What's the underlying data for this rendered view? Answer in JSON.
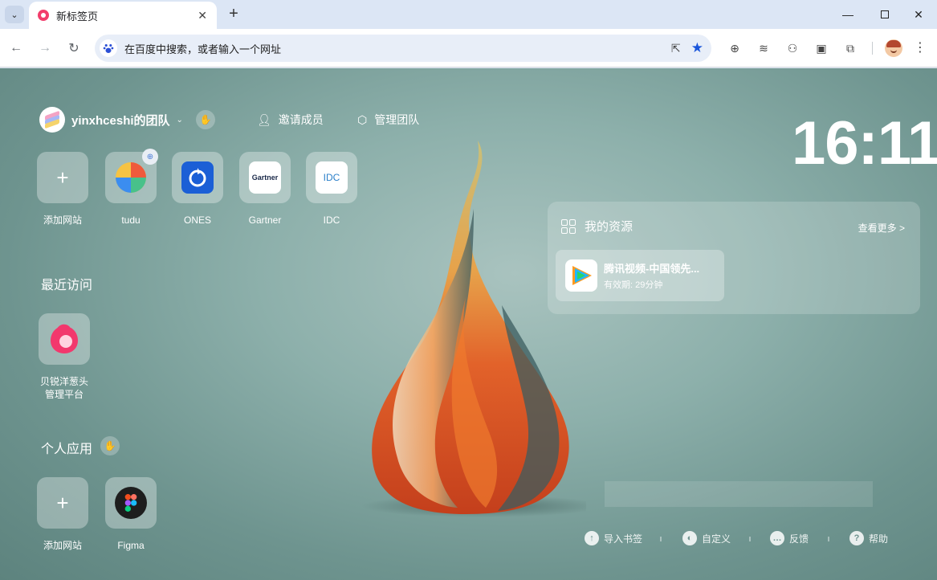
{
  "browser": {
    "tab_title": "新标签页",
    "omnibox_placeholder": "在百度中搜索，或者输入一个网址"
  },
  "team": {
    "name": "yinxhceshi的团队",
    "invite_label": "邀请成员",
    "manage_label": "管理团队"
  },
  "top_sites": [
    {
      "label": "添加网站",
      "icon": "plus-icon"
    },
    {
      "label": "tudu",
      "icon": "tudu-icon"
    },
    {
      "label": "ONES",
      "icon": "ones-icon"
    },
    {
      "label": "Gartner",
      "icon": "gartner-icon",
      "logo_text": "Gartner"
    },
    {
      "label": "IDC",
      "icon": "idc-icon",
      "logo_text": "IDC"
    }
  ],
  "recent": {
    "title": "最近访问",
    "items": [
      {
        "label_line1": "贝锐洋葱头",
        "label_line2": "管理平台",
        "icon": "onion-icon"
      }
    ]
  },
  "personal": {
    "title": "个人应用",
    "items": [
      {
        "label": "添加网站",
        "icon": "plus-icon"
      },
      {
        "label": "Figma",
        "icon": "figma-icon"
      }
    ]
  },
  "clock": {
    "time": "16:11"
  },
  "resources": {
    "title": "我的资源",
    "more_label": "查看更多 >",
    "items": [
      {
        "name": "腾讯视频-中国领先...",
        "validity": "有效期: 29分钟",
        "icon": "tencent-video-icon"
      }
    ]
  },
  "footer": {
    "import_bookmarks": "导入书签",
    "customize": "自定义",
    "feedback": "反馈",
    "help": "帮助"
  },
  "colors": {
    "background": "#8db0ab",
    "accent_star": "#1a56db",
    "tab_favicon": "#f23d6b"
  }
}
